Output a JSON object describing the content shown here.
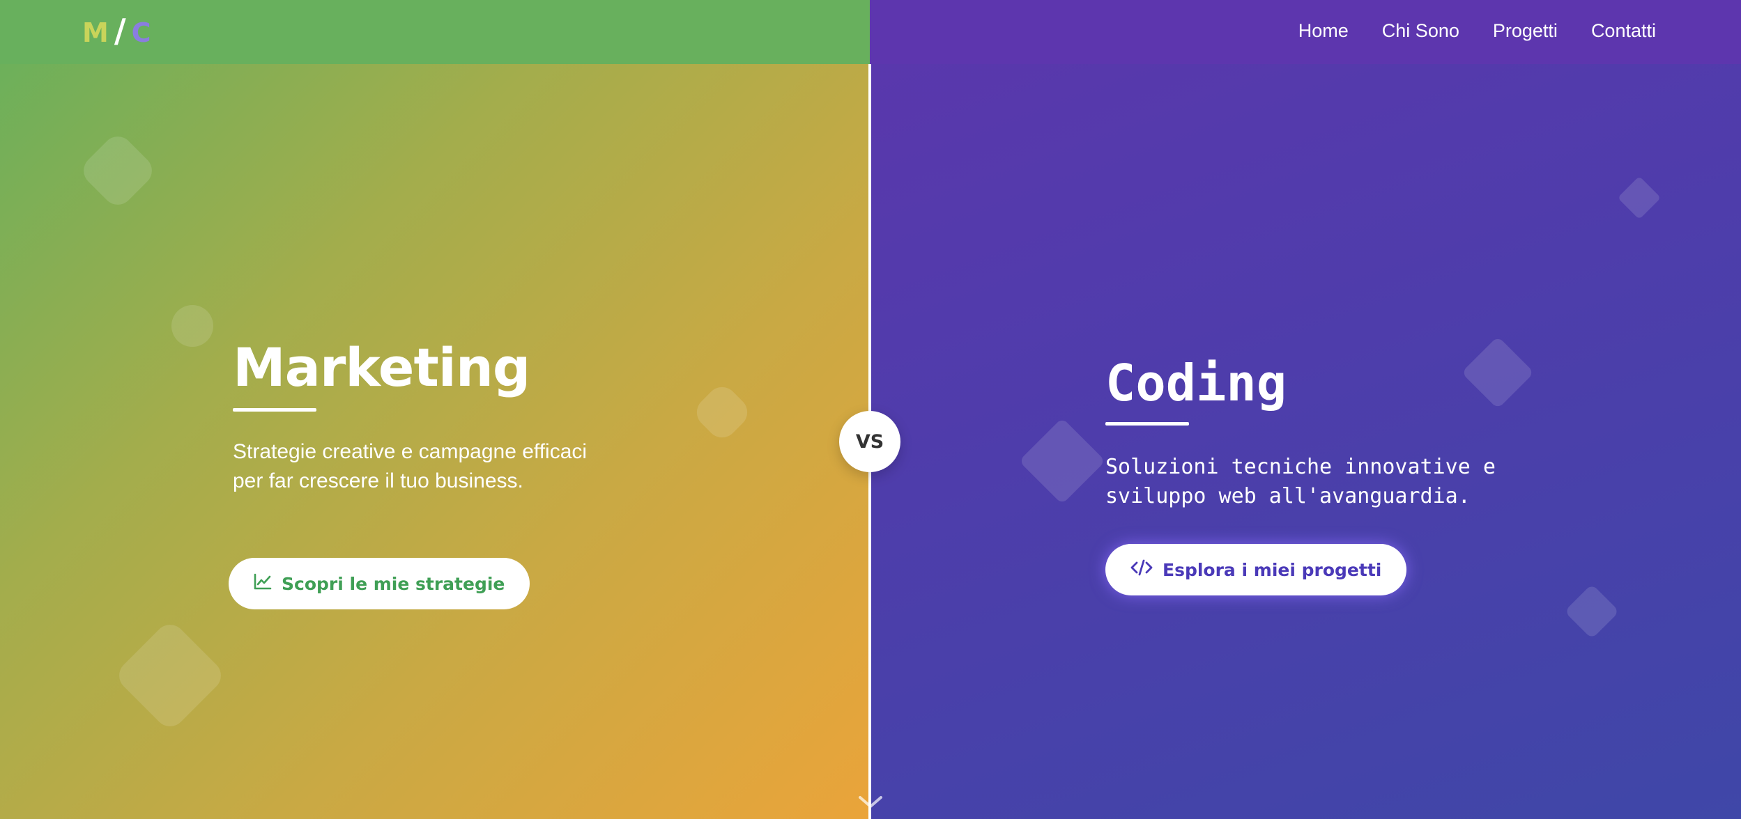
{
  "header": {
    "logo": {
      "left": "M",
      "separator": "/",
      "right": "C"
    },
    "nav": [
      {
        "label": "Home"
      },
      {
        "label": "Chi Sono"
      },
      {
        "label": "Progetti"
      },
      {
        "label": "Contatti"
      }
    ]
  },
  "divider": {
    "badge": "VS"
  },
  "marketing": {
    "title": "Marketing",
    "description": "Strategie creative e campagne efficaci per far crescere il tuo business.",
    "button_label": "Scopri le mie strategie",
    "button_icon": "chart-line-icon"
  },
  "coding": {
    "title": "Coding",
    "description": "Soluzioni tecniche innovative e sviluppo web all'avanguardia.",
    "button_label": "Esplora i miei progetti",
    "button_icon": "code-icon"
  },
  "colors": {
    "marketing_green": "#68b05d",
    "marketing_orange": "#eaa43a",
    "coding_purple": "#5d36ae",
    "coding_indigo": "#3f47a8",
    "marketing_button_text": "#3f9f55",
    "coding_button_text": "#4a39b8"
  }
}
